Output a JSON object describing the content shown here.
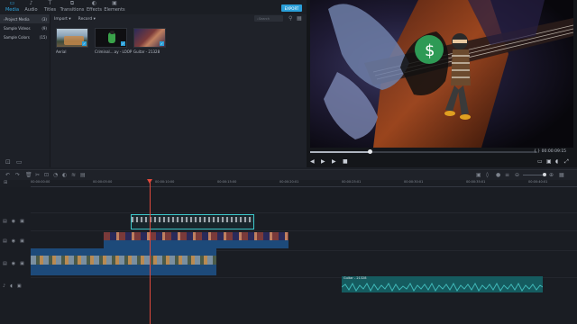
{
  "tabs": [
    {
      "label": "Media",
      "icon": "folder-icon",
      "active": true
    },
    {
      "label": "Audio",
      "icon": "music-icon",
      "active": false
    },
    {
      "label": "Titles",
      "icon": "text-icon",
      "active": false
    },
    {
      "label": "Transitions",
      "icon": "transition-icon",
      "active": false
    },
    {
      "label": "Effects",
      "icon": "effects-icon",
      "active": false
    },
    {
      "label": "Elements",
      "icon": "elements-icon",
      "active": false
    }
  ],
  "export_label": "EXPORT",
  "nav": [
    {
      "label": "Project Media",
      "count": "(3)"
    },
    {
      "label": "Sample Videos",
      "count": "(9)"
    },
    {
      "label": "Sample Colors",
      "count": "(15)"
    }
  ],
  "media_toolbar": {
    "import": "Import",
    "record": "Record",
    "search_placeholder": "Search"
  },
  "media_items": [
    {
      "caption": "Aerial"
    },
    {
      "caption": "Criminal....ay - LOOP"
    },
    {
      "caption": "Guitar - 21328"
    }
  ],
  "preview": {
    "timecode": "00:00:09:15",
    "progress": 0.26
  },
  "ruler_labels": [
    "00:00:00:00",
    "00:00:05:00",
    "00:00:10:00",
    "00:00:15:00",
    "00:00:20:01",
    "00:00:25:01",
    "00:00:30:01",
    "00:00:35:01",
    "00:00:40:01"
  ],
  "clips": {
    "audio_label": "Guitar - 21328"
  },
  "colors": {
    "accent": "#2a9fd8",
    "playhead": "#e04a3c",
    "audio": "#1f8a8c"
  }
}
